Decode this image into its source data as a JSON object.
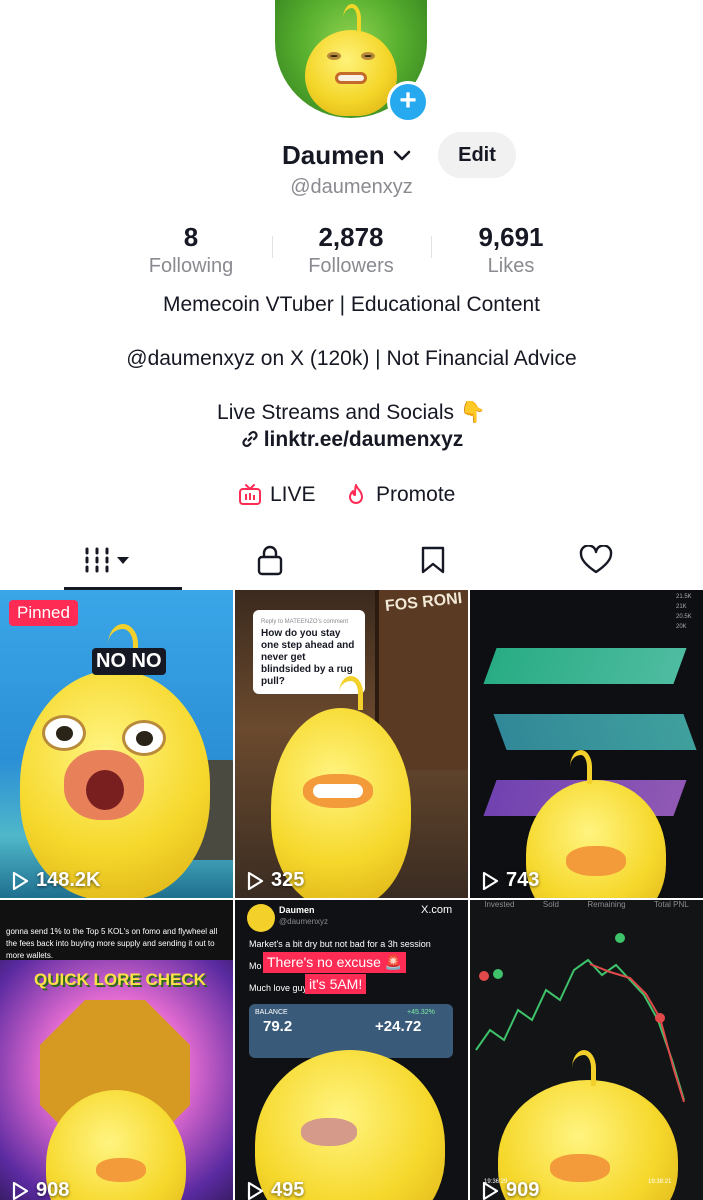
{
  "profile": {
    "display_name": "Daumen",
    "handle": "@daumenxyz",
    "edit_label": "Edit"
  },
  "stats": [
    {
      "value": "8",
      "label": "Following"
    },
    {
      "value": "2,878",
      "label": "Followers"
    },
    {
      "value": "9,691",
      "label": "Likes"
    }
  ],
  "bio": {
    "line1": "Memecoin VTuber | Educational Content",
    "line2": "@daumenxyz on X (120k) | Not Financial Advice",
    "line3": "Live Streams and Socials 👇",
    "link": "linktr.ee/daumenxyz"
  },
  "actions": {
    "live_label": "LIVE",
    "promote_label": "Promote"
  },
  "tabs": [
    {
      "icon": "grid-icon",
      "active": true
    },
    {
      "icon": "lock-icon",
      "active": false
    },
    {
      "icon": "bookmark-icon",
      "active": false
    },
    {
      "icon": "heart-icon",
      "active": false
    }
  ],
  "videos": [
    {
      "views": "148.2K",
      "pinned_label": "Pinned",
      "caption": "NO NO"
    },
    {
      "views": "325",
      "comment_header": "Reply to MATEENZO's comment",
      "comment": "How do you stay one step ahead and never get blindsided by a rug pull?",
      "sign": "FOS RONI"
    },
    {
      "views": "743",
      "axis_ticks": [
        "21.5K",
        "21K",
        "20.5K",
        "20K"
      ]
    },
    {
      "views": "908",
      "text": "gonna send 1% to the Top 5 KOL's on fomo and flywheel all the fees back into buying more supply and sending it out to more wallets.",
      "banner": "QUICK LORE CHECK"
    },
    {
      "views": "495",
      "post_name": "Daumen",
      "post_handle": "@daumenxyz",
      "post_site": "X.com",
      "post_text": "Market's a bit dry but not bad for a 3h session",
      "overlay1": "There's no excuse 🚨",
      "overlay2": "it's 5AM!",
      "post_line3_prefix": "Mo",
      "post_line4": "Much love guy",
      "balance_label": "BALANCE",
      "balance_value": "79.2",
      "pnl_value": "+24.72",
      "pnl_pct": "+45.32%"
    },
    {
      "views": "909",
      "headers": [
        "Invested",
        "Sold",
        "Remaining",
        "Total PNL"
      ],
      "times": [
        "19:36:29",
        "19:38:21"
      ]
    }
  ],
  "colors": {
    "accent_red": "#fe2c55",
    "plus_blue": "#26a9ef",
    "muted_text": "#8a8b91"
  }
}
